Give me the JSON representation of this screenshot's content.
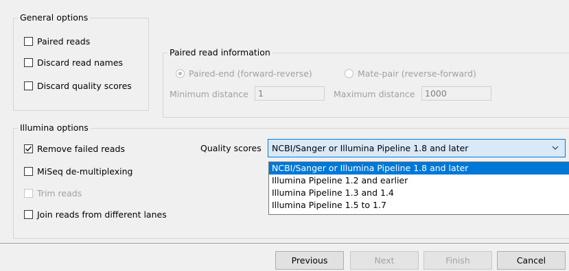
{
  "general": {
    "title": "General options",
    "paired_reads": {
      "label": "Paired reads",
      "checked": false
    },
    "discard_names": {
      "label": "Discard read names",
      "checked": false
    },
    "discard_quality": {
      "label": "Discard quality scores",
      "checked": false
    }
  },
  "paired_info": {
    "title": "Paired read information",
    "radio_paired_end": {
      "label": "Paired-end (forward-reverse)",
      "selected": true
    },
    "radio_mate_pair": {
      "label": "Mate-pair (reverse-forward)",
      "selected": false
    },
    "min_distance_label": "Minimum distance",
    "min_distance_value": "1",
    "max_distance_label": "Maximum distance",
    "max_distance_value": "1000"
  },
  "illumina": {
    "title": "Illumina options",
    "remove_failed": {
      "label": "Remove failed reads",
      "checked": true
    },
    "miseq": {
      "label": "MiSeq de-multiplexing",
      "checked": false
    },
    "trim": {
      "label": "Trim reads",
      "checked": false,
      "disabled": true
    },
    "join_lanes": {
      "label": "Join reads from different lanes",
      "checked": false
    },
    "quality_label": "Quality scores",
    "quality_selected": "NCBI/Sanger or Illumina Pipeline 1.8 and later",
    "quality_options": [
      "NCBI/Sanger or Illumina Pipeline 1.8 and later",
      "Illumina Pipeline 1.2 and earlier",
      "Illumina Pipeline 1.3 and 1.4",
      "Illumina Pipeline 1.5 to 1.7"
    ]
  },
  "buttons": {
    "previous": "Previous",
    "next": "Next",
    "finish": "Finish",
    "cancel": "Cancel"
  },
  "colors": {
    "accent": "#0078d7",
    "window_bg": "#f0f0f0"
  }
}
